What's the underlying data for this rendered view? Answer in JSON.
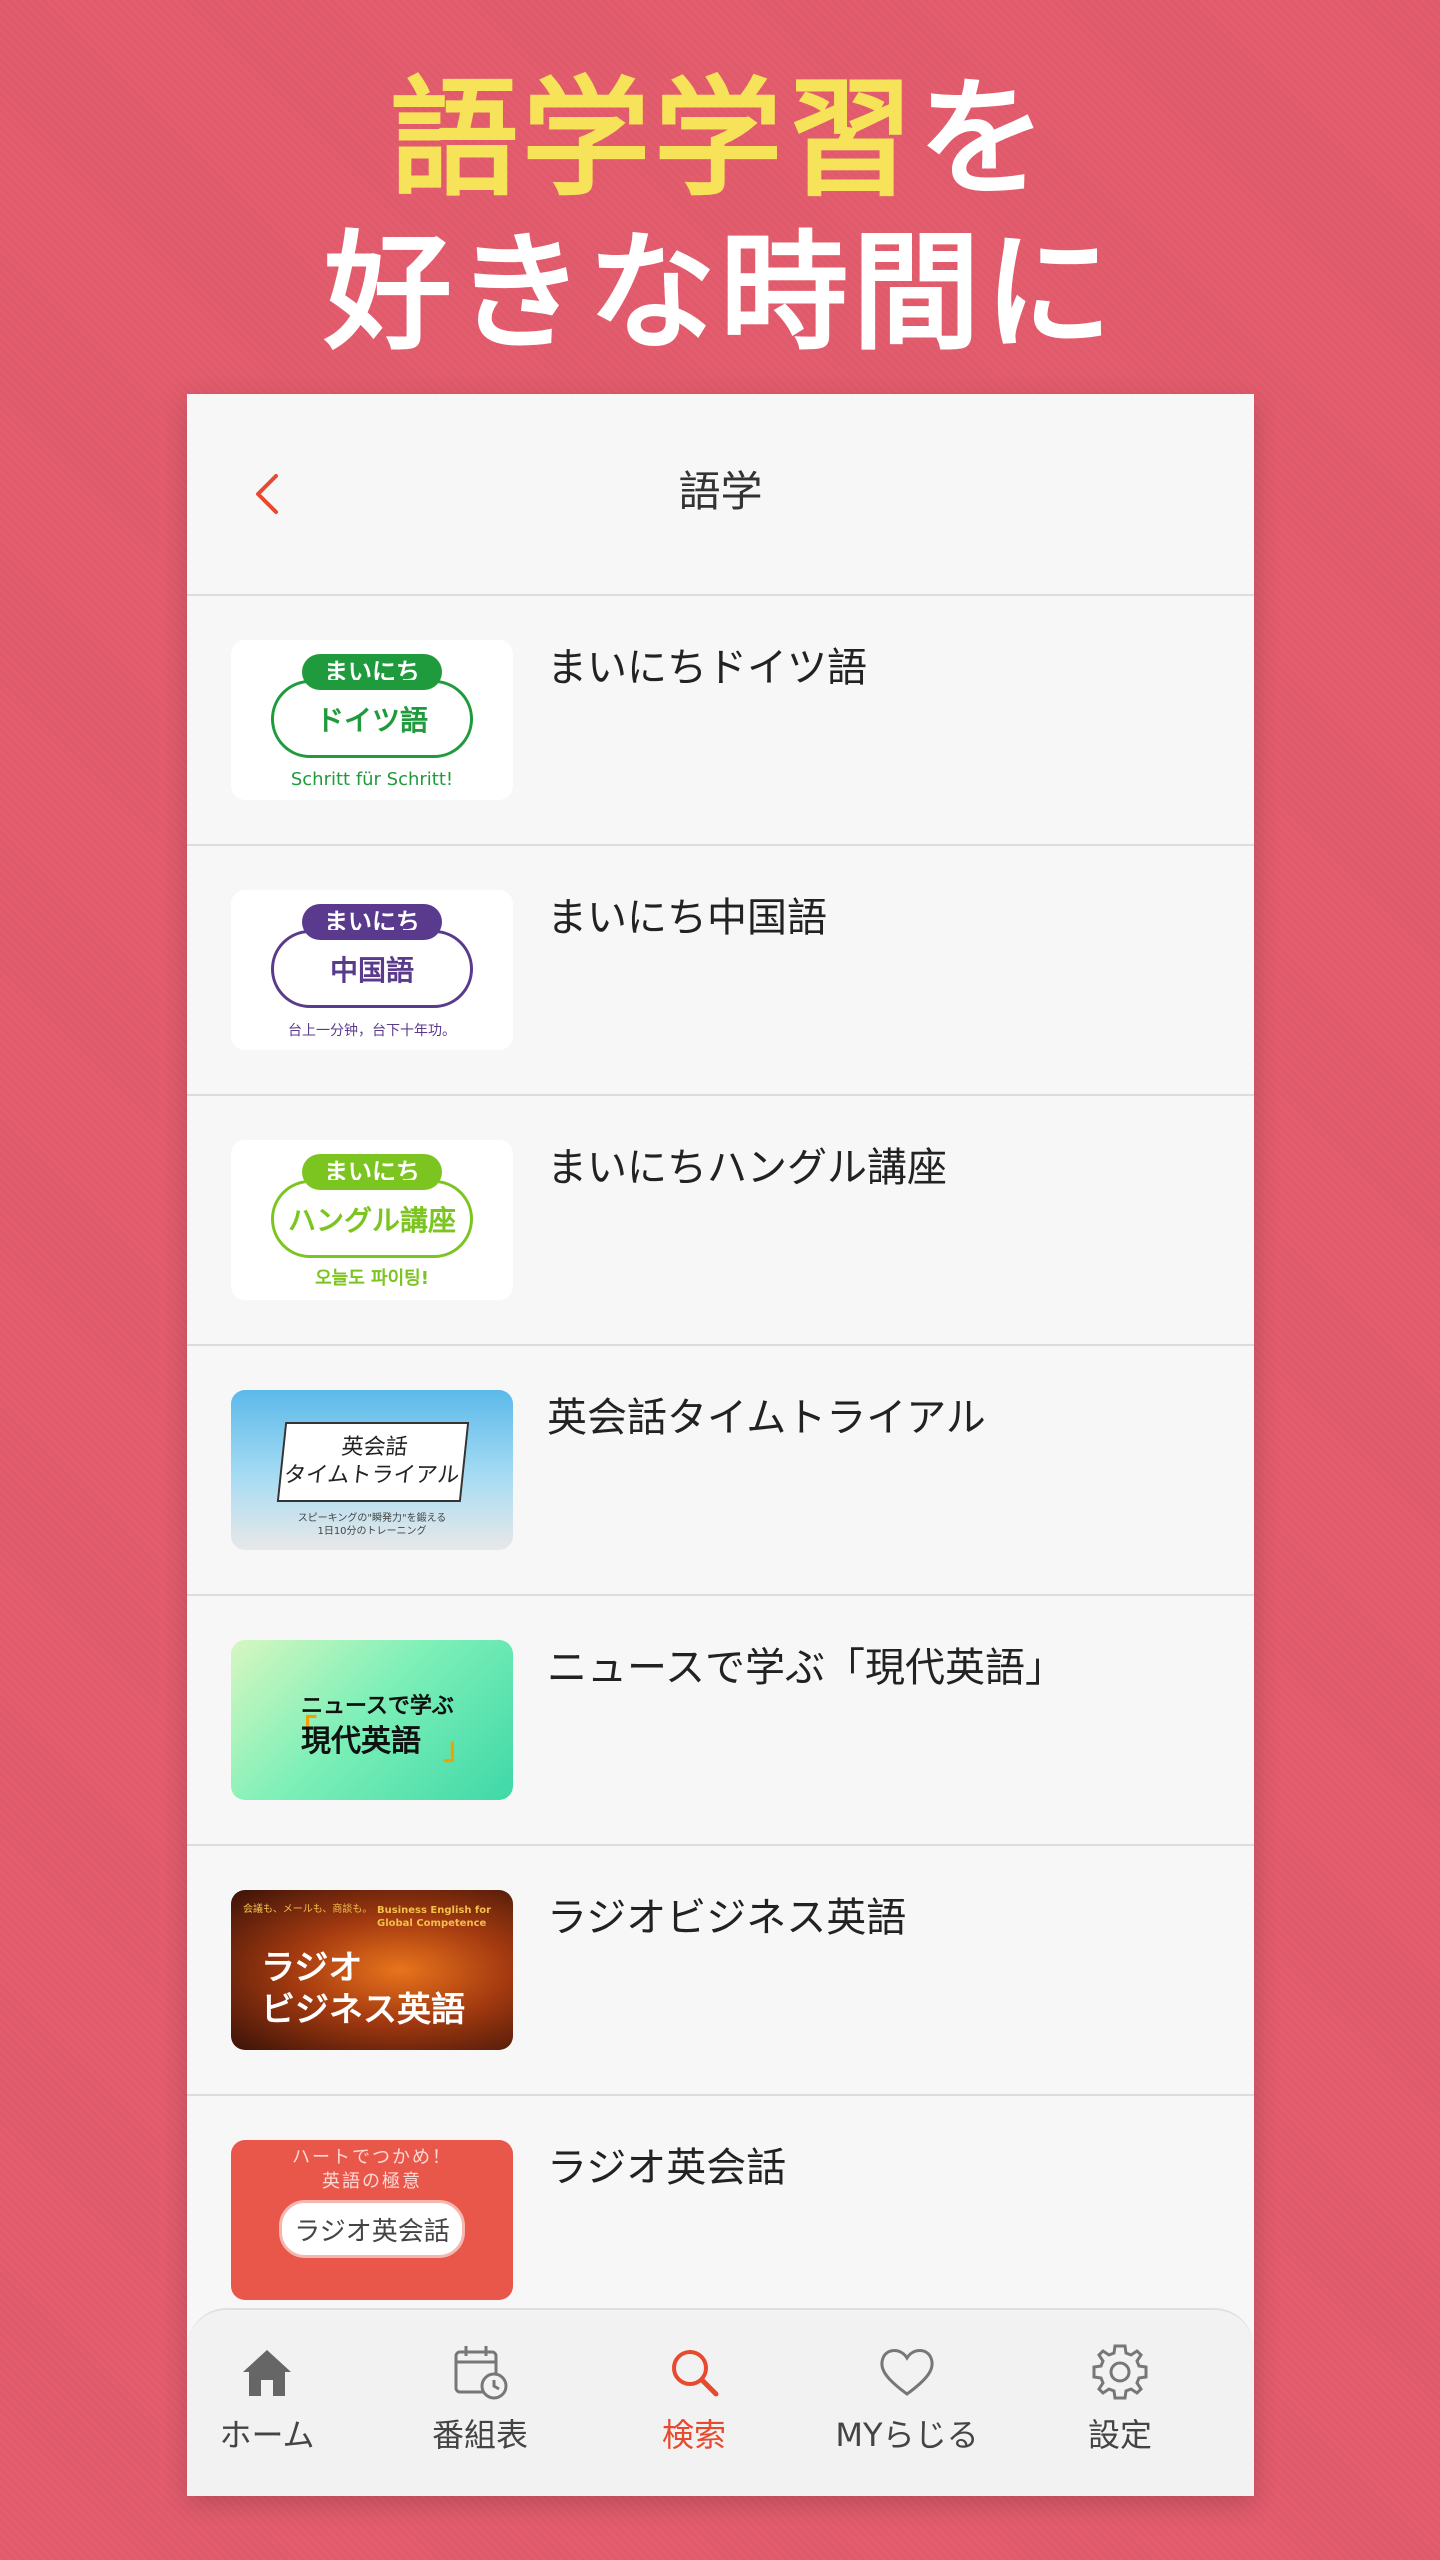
{
  "headline": {
    "line1_highlight": "語学学習",
    "line1_rest": "を",
    "line2": "好きな時間に"
  },
  "navbar": {
    "title": "語学",
    "back_icon": "chevron-left-icon"
  },
  "programs": [
    {
      "title": "まいにちドイツ語",
      "thumb": {
        "pill": "まいにち",
        "name": "ドイツ語",
        "tagline": "Schritt für Schritt!",
        "color": "#1f9a3c"
      }
    },
    {
      "title": "まいにち中国語",
      "thumb": {
        "pill": "まいにち",
        "name": "中国語",
        "tagline": "台上一分钟，台下十年功。",
        "color": "#5a3a8c"
      }
    },
    {
      "title": "まいにちハングル講座",
      "thumb": {
        "pill": "まいにち",
        "name": "ハングル講座",
        "tagline": "오늘도 파이팅!",
        "color": "#7cc520"
      }
    },
    {
      "title": "英会話タイムトライアル",
      "thumb": {
        "line1": "英会話",
        "line2": "タイムトライアル",
        "sub1": "スピーキングの\"瞬発力\"を鍛える",
        "sub2": "1日10分のトレーニング"
      }
    },
    {
      "title": "ニュースで学ぶ「現代英語」",
      "thumb": {
        "line1": "ニュースで学ぶ",
        "line2": "現代英語"
      }
    },
    {
      "title": "ラジオビジネス英語",
      "thumb": {
        "small": "会議も、メールも、商談も。",
        "en": "Business English for Global Competence",
        "line1": "ラジオ",
        "line2": "ビジネス英語"
      }
    },
    {
      "title": "ラジオ英会話",
      "thumb": {
        "top1": "ハートでつかめ！",
        "top2": "英語の極意",
        "label": "ラジオ英会話"
      }
    }
  ],
  "tabbar": {
    "items": [
      {
        "label": "ホーム",
        "icon": "home-icon"
      },
      {
        "label": "番組表",
        "icon": "calendar-clock-icon"
      },
      {
        "label": "検索",
        "icon": "search-icon",
        "active": true
      },
      {
        "label": "MYらじる",
        "icon": "heart-icon"
      },
      {
        "label": "設定",
        "icon": "gear-icon"
      }
    ],
    "active_color": "#e84a2f"
  }
}
